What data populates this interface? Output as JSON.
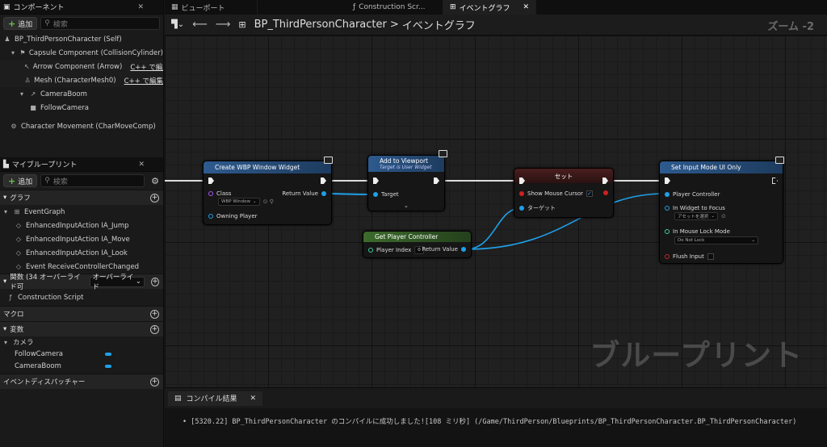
{
  "components_panel": {
    "tab": "コンポーネント",
    "add": "追加",
    "search_placeholder": "検索",
    "items": [
      {
        "label": "BP_ThirdPersonCharacter (Self)",
        "icon": "person-icon",
        "cpp": ""
      },
      {
        "label": "Capsule Component (CollisionCylinder)",
        "icon": "capsule-icon",
        "cpp": ""
      },
      {
        "label": "Arrow Component (Arrow)",
        "icon": "arrow-icon",
        "cpp": "C++ で編集"
      },
      {
        "label": "Mesh (CharacterMesh0)",
        "icon": "mesh-icon",
        "cpp": "C++ で編集"
      },
      {
        "label": "CameraBoom",
        "icon": "boom-icon",
        "cpp": ""
      },
      {
        "label": "FollowCamera",
        "icon": "camera-icon",
        "cpp": ""
      },
      {
        "label": "Character Movement (CharMoveComp)",
        "icon": "movement-icon",
        "cpp": ""
      }
    ]
  },
  "blueprint_panel": {
    "tab": "マイブループリント",
    "add": "追加",
    "search_placeholder": "検索",
    "graph_section": "グラフ",
    "event_graph": "EventGraph",
    "events": [
      "EnhancedInputAction IA_Jump",
      "EnhancedInputAction IA_Move",
      "EnhancedInputAction IA_Look",
      "Event ReceiveControllerChanged"
    ],
    "functions_section": "関数 (34 オーバーライド可",
    "override_label": "オーバーライド",
    "construction_script": "Construction Script",
    "macros_section": "マクロ",
    "variables_section": "変数",
    "camera_category": "カメラ",
    "variables": [
      "FollowCamera",
      "CameraBoom"
    ],
    "dispatchers_section": "イベントディスパッチャー"
  },
  "tabs": [
    "ビューポート",
    "Construction Scr...",
    "イベントグラフ"
  ],
  "breadcrumb": {
    "blueprint": "BP_ThirdPersonCharacter",
    "separator": ">",
    "graph": "イベントグラフ"
  },
  "zoom": "ズーム -2",
  "watermark": "ブループリント",
  "nodes": {
    "create_widget": {
      "title": "Create WBP Window Widget",
      "class_label": "Class",
      "class_value": "WBP Window",
      "return_label": "Return Value",
      "owning_player": "Owning Player"
    },
    "add_viewport": {
      "title": "Add to Viewport",
      "subtitle": "Target is User Widget",
      "target": "Target"
    },
    "set": {
      "title": "セット",
      "show_mouse": "Show Mouse Cursor",
      "target": "ターゲット"
    },
    "get_pc": {
      "title": "Get Player Controller",
      "player_index": "Player Index",
      "player_index_value": "0",
      "return_label": "Return Value"
    },
    "set_input": {
      "title": "Set Input Mode UI Only",
      "player_controller": "Player Controller",
      "in_widget": "In Widget to Focus",
      "asset_select": "アセットを選択",
      "lock_mode": "In Mouse Lock Mode",
      "lock_value": "Do Not Lock",
      "flush": "Flush Input"
    }
  },
  "output": {
    "tab": "コンパイル結果",
    "message": "[5320.22] BP_ThirdPersonCharacter のコンパイルに成功しました![108 ミリ秒] (/Game/ThirdPerson/Blueprints/BP_ThirdPersonCharacter.BP_ThirdPersonCharacter)"
  },
  "colors": {
    "exec": "#eeeeee",
    "object_pin": "#1fa0e8",
    "bool_pin": "#cc2222",
    "function_header": "#2e5a8e",
    "pure_header": "#3c6a2c"
  }
}
